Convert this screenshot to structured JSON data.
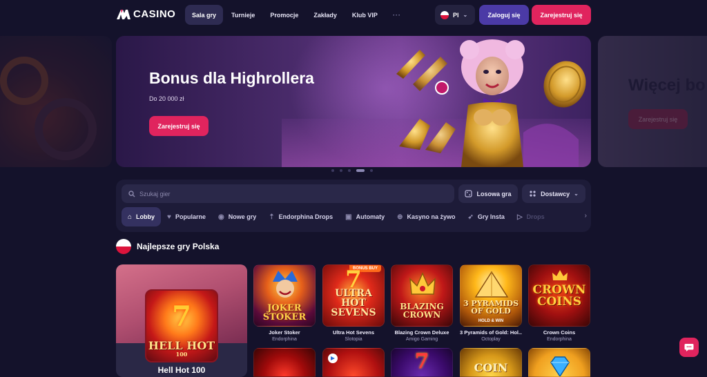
{
  "header": {
    "logo_text": "CASINO",
    "nav": [
      {
        "label": "Sala gry",
        "active": true
      },
      {
        "label": "Turnieje",
        "active": false
      },
      {
        "label": "Promocje",
        "active": false
      },
      {
        "label": "Zakłady",
        "active": false
      },
      {
        "label": "Klub VIP",
        "active": false
      }
    ],
    "more": "···",
    "language": "Pl",
    "login_label": "Zaloguj się",
    "register_label": "Zarejestruj się"
  },
  "hero": {
    "title": "Bonus dla Highrollera",
    "subtitle": "Do 20 000 zł",
    "button": "Zarejestruj się",
    "next_title": "Więcej bo",
    "next_button": "Zarejestruj się",
    "slide_count": 5,
    "active_slide": 4
  },
  "search": {
    "placeholder": "Szukaj gier",
    "random_label": "Losowa gra",
    "providers_label": "Dostawcy"
  },
  "categories": [
    {
      "label": "Lobby",
      "icon": "home-icon",
      "active": true
    },
    {
      "label": "Popularne",
      "icon": "heart-icon",
      "active": false
    },
    {
      "label": "Nowe gry",
      "icon": "new-icon",
      "active": false
    },
    {
      "label": "Endorphina Drops",
      "icon": "drops-icon",
      "active": false
    },
    {
      "label": "Automaty",
      "icon": "slot-icon",
      "active": false
    },
    {
      "label": "Kasyno na żywo",
      "icon": "live-icon",
      "active": false
    },
    {
      "label": "Gry Insta",
      "icon": "rocket-icon",
      "active": false
    },
    {
      "label": "Drops",
      "icon": "drops-icon",
      "active": false
    }
  ],
  "section": {
    "title": "Najlepsze gry Polska",
    "featured": {
      "name": "Hell Hot 100",
      "art_text": "HELL HOT",
      "art_small": "100"
    },
    "games": [
      {
        "name": "Joker Stoker",
        "provider": "Endorphina",
        "art_text": "JOKER STOKER"
      },
      {
        "name": "Ultra Hot Sevens",
        "provider": "Slotopia",
        "art_text": "ULTRA HOT SEVENS",
        "badge": "BONUS BUY"
      },
      {
        "name": "Blazing Crown Deluxe",
        "provider": "Amigo Gaming",
        "art_text": "BLAZING CROWN"
      },
      {
        "name": "3 Pyramids of Gold: Hol...",
        "provider": "Octoplay",
        "art_text": "3 PYRAMIDS OF GOLD",
        "art_small": "HOLD & WIN"
      },
      {
        "name": "Crown Coins",
        "provider": "Endorphina",
        "art_text": "CROWN COINS"
      }
    ],
    "row2_art": [
      "",
      "",
      "7",
      "COIN",
      ""
    ]
  },
  "colors": {
    "background": "#14122b",
    "accent_pink": "#e0245e",
    "accent_purple": "#4b3aa6",
    "panel": "#1d1b38"
  }
}
